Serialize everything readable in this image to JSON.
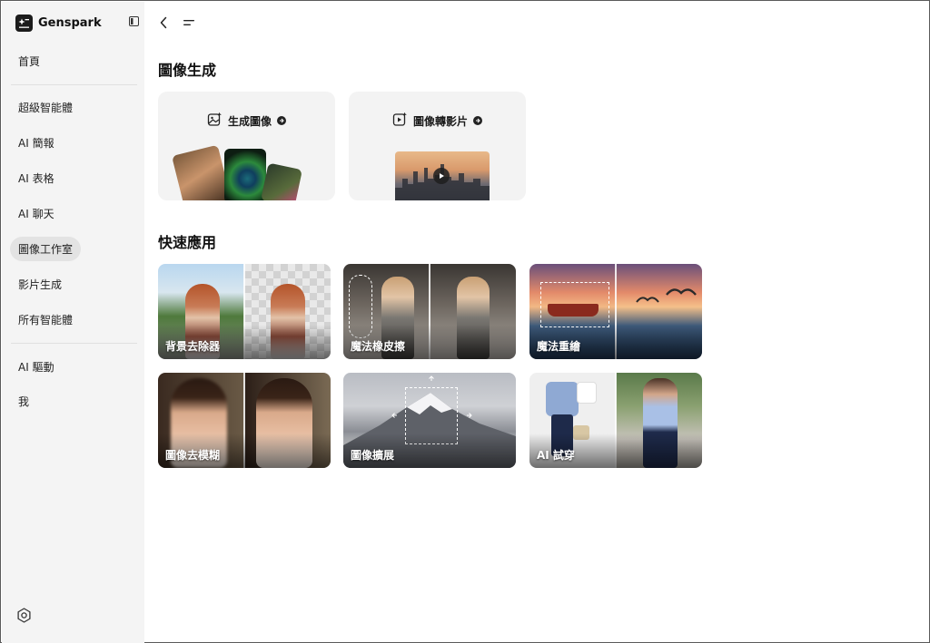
{
  "brand": {
    "name": "Genspark"
  },
  "sidebar": {
    "home": "首頁",
    "items": [
      {
        "label": "超級智能體"
      },
      {
        "label": "AI 簡報"
      },
      {
        "label": "AI 表格"
      },
      {
        "label": "AI 聊天"
      },
      {
        "label": "圖像工作室",
        "active": true
      },
      {
        "label": "影片生成"
      },
      {
        "label": "所有智能體"
      }
    ],
    "bottom_items": [
      {
        "label": "AI 驅動"
      },
      {
        "label": "我"
      }
    ]
  },
  "main": {
    "generate_title": "圖像生成",
    "generate_cards": [
      {
        "label": "生成圖像",
        "icon": "image-sparkle-icon"
      },
      {
        "label": "圖像轉影片",
        "icon": "video-sparkle-icon"
      }
    ],
    "quick_title": "快速應用",
    "apps": [
      {
        "label": "背景去除器"
      },
      {
        "label": "魔法橡皮擦"
      },
      {
        "label": "魔法重繪"
      },
      {
        "label": "圖像去模糊"
      },
      {
        "label": "圖像擴展"
      },
      {
        "label": "AI 試穿"
      }
    ]
  },
  "colors": {
    "sidebar_bg": "#f4f4f4",
    "active_bg": "#e3e3e3",
    "card_bg": "#f3f3f3",
    "text": "#1f1f1f"
  }
}
